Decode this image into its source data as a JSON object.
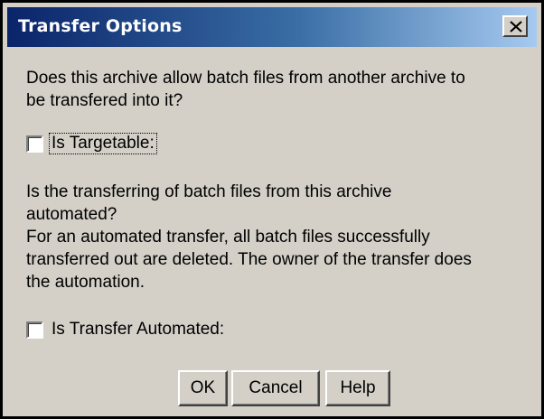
{
  "window": {
    "title": "Transfer Options"
  },
  "question1": {
    "lines": [
      "Does this archive allow batch files from another archive to",
      "be transfered into it?"
    ]
  },
  "checkbox_targetable": {
    "label": "Is Targetable:",
    "checked": false
  },
  "question2": {
    "lines": [
      "Is the transferring of batch files from this archive",
      "automated?",
      "For an automated transfer, all batch files successfully",
      "transferred out are deleted. The owner of the transfer does",
      "the automation."
    ]
  },
  "checkbox_automated": {
    "label": "Is Transfer Automated:",
    "checked": false
  },
  "buttons": {
    "ok": "OK",
    "cancel": "Cancel",
    "help": "Help"
  },
  "icons": {
    "close": "close-icon"
  },
  "colors": {
    "titlebar_start": "#0a246a",
    "titlebar_end": "#a6caf0",
    "dialog_face": "#d4d0c8"
  }
}
